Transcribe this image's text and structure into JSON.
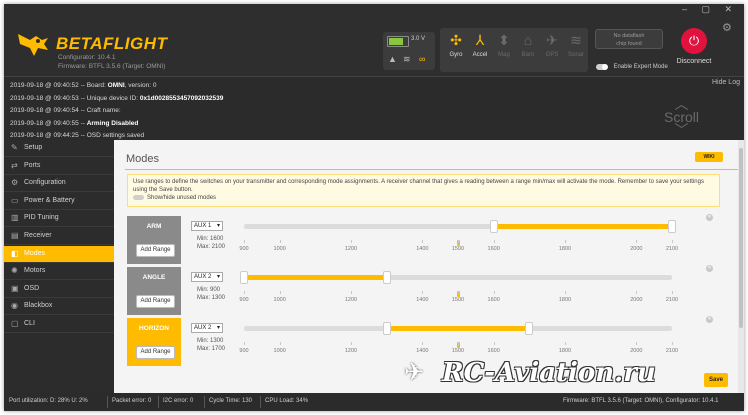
{
  "window": {
    "controls": "– ▢ ✕"
  },
  "app": {
    "name": "BETAFLIGHT",
    "configurator": "Configurator: 10.4.1",
    "firmware": "Firmware: BTFL 3.5.6 (Target: OMNI)"
  },
  "battery": {
    "voltage": "3.0 V",
    "level_fraction": 0.7
  },
  "sensors": [
    {
      "label": "Gyro",
      "icon": "gyro-icon",
      "active": true
    },
    {
      "label": "Accel",
      "icon": "accel-icon",
      "active": true
    },
    {
      "label": "Mag",
      "icon": "mag-icon",
      "active": false
    },
    {
      "label": "Baro",
      "icon": "baro-icon",
      "active": false
    },
    {
      "label": "GPS",
      "icon": "gps-icon",
      "active": false
    },
    {
      "label": "Sonar",
      "icon": "sonar-icon",
      "active": false
    }
  ],
  "dataflash": {
    "line1": "No dataflash",
    "line2": "chip found"
  },
  "expert_mode": "Enable Expert Mode",
  "disconnect": {
    "label": "Disconnect"
  },
  "log": {
    "hide": "Hide Log",
    "scroll": "Scroll",
    "lines": [
      {
        "prefix": "2019-09-18 @ 09:40:52 -- Board: ",
        "bold": "OMNI",
        "suffix": ", version: 0"
      },
      {
        "prefix": "2019-09-18 @ 09:40:53 -- Unique device ID: ",
        "bold": "0x1d0028553457092032539",
        "suffix": ""
      },
      {
        "prefix": "2019-09-18 @ 09:40:54 -- Craft name: ",
        "bold": "",
        "suffix": ""
      },
      {
        "prefix": "2019-09-18 @ 09:40:55 -- ",
        "bold": "Arming Disabled",
        "suffix": ""
      },
      {
        "prefix": "2019-09-18 @ 09:44:25 -- OSD settings saved",
        "bold": "",
        "suffix": ""
      }
    ]
  },
  "nav": [
    {
      "label": "Setup",
      "icon": "wrench-icon",
      "glyph": "✎",
      "active": false
    },
    {
      "label": "Ports",
      "icon": "ports-icon",
      "glyph": "⇄",
      "active": false
    },
    {
      "label": "Configuration",
      "icon": "gear-icon",
      "glyph": "⚙",
      "active": false
    },
    {
      "label": "Power & Battery",
      "icon": "battery-icon",
      "glyph": "▭",
      "active": false
    },
    {
      "label": "PID Tuning",
      "icon": "pid-icon",
      "glyph": "▥",
      "active": false
    },
    {
      "label": "Receiver",
      "icon": "receiver-icon",
      "glyph": "▤",
      "active": false
    },
    {
      "label": "Modes",
      "icon": "modes-icon",
      "glyph": "◧",
      "active": true
    },
    {
      "label": "Motors",
      "icon": "motors-icon",
      "glyph": "✺",
      "active": false
    },
    {
      "label": "OSD",
      "icon": "osd-icon",
      "glyph": "▣",
      "active": false
    },
    {
      "label": "Blackbox",
      "icon": "blackbox-icon",
      "glyph": "◉",
      "active": false
    },
    {
      "label": "CLI",
      "icon": "cli-icon",
      "glyph": "▢",
      "active": false
    }
  ],
  "page": {
    "title": "Modes",
    "wiki": "WIKI",
    "note": "Use ranges to define the switches on your transmitter and corresponding mode assignments. A receiver channel that gives a reading between a range min/max will activate the mode. Remember to save your settings using the Save button.",
    "show_hide": "Show/hide unused modes",
    "add_range": "Add Range",
    "save": "Save"
  },
  "scale": {
    "ticks": [
      900,
      1000,
      1200,
      1400,
      1500,
      1600,
      1800,
      2000,
      2100
    ]
  },
  "modes": [
    {
      "name": "ARM",
      "channel": "AUX 1",
      "min_text": "Min: 1600",
      "max_text": "Max: 2100",
      "min": 1600,
      "max": 2100,
      "current": 1500,
      "highlight": false
    },
    {
      "name": "ANGLE",
      "channel": "AUX 2",
      "min_text": "Min: 900",
      "max_text": "Max: 1300",
      "min": 900,
      "max": 1300,
      "current": 1500,
      "highlight": false
    },
    {
      "name": "HORIZON",
      "channel": "AUX 2",
      "min_text": "Min: 1300",
      "max_text": "Max: 1700",
      "min": 1300,
      "max": 1700,
      "current": 1500,
      "highlight": true
    }
  ],
  "watermark": "RC-Aviation.ru",
  "statusbar": {
    "port": "Port utilization: D: 28% U: 2%",
    "packet": "Packet error: 0",
    "i2c": "I2C error: 0",
    "cycle": "Cycle Time: 130",
    "cpu": "CPU Load: 34%",
    "version": "Firmware: BTFL 3.5.6 (Target: OMNI), Configurator: 10.4.1"
  }
}
